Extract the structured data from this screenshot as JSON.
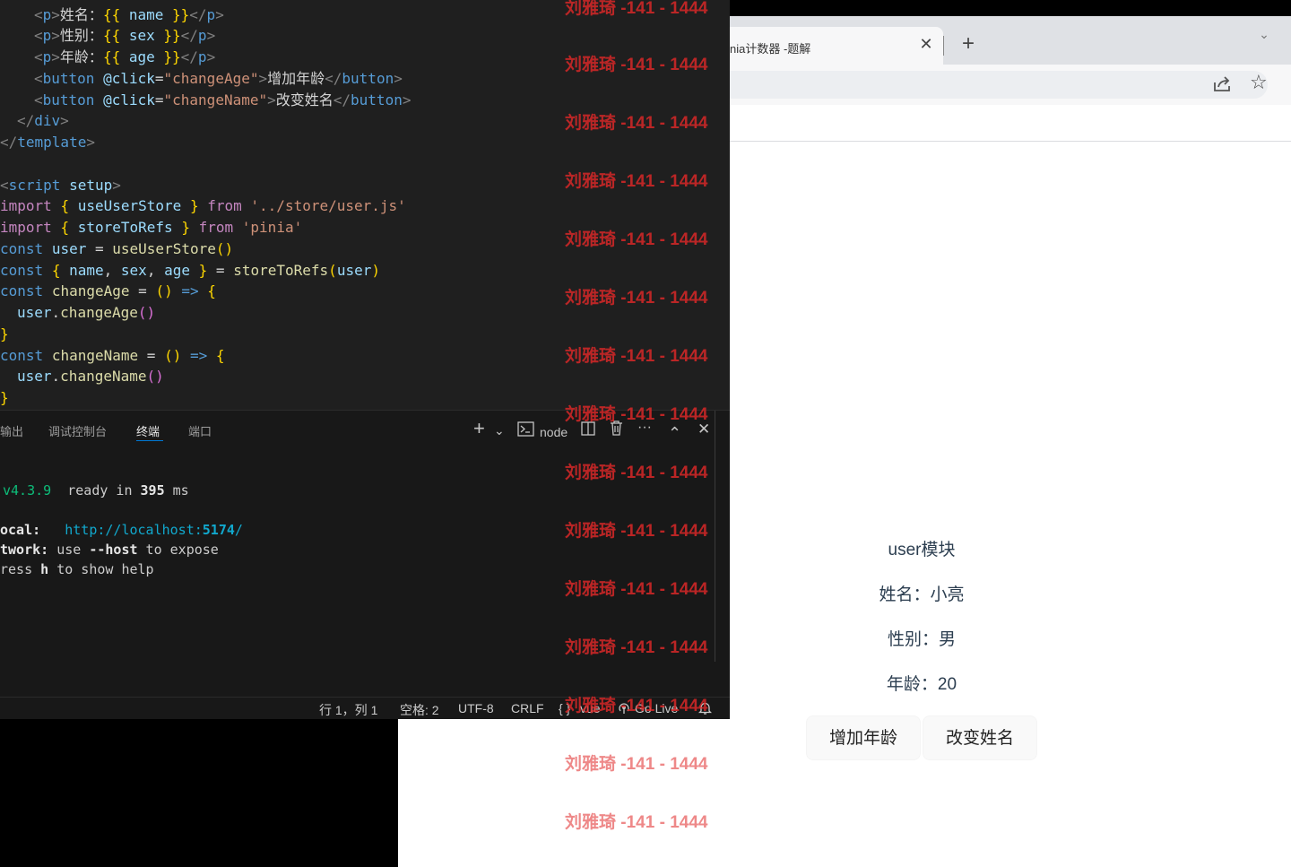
{
  "browser": {
    "tab_title": "nia计数器 -题解",
    "close_glyph": "✕",
    "new_tab_glyph": "+",
    "tab_search_glyph": "⌄",
    "star_glyph": "☆"
  },
  "app": {
    "title": "user模块",
    "name_line": "姓名：小亮",
    "sex_line": "性别：男",
    "age_line": "年龄：20",
    "btn_increase_age": "增加年龄",
    "btn_change_name": "改变姓名"
  },
  "editor": {
    "lines": [
      "  <p>姓名：{{ name }}</p>",
      "  <p>性别：{{ sex }}</p>",
      "  <p>年龄：{{ age }}</p>",
      "  <button @click=\"changeAge\">增加年龄</button>",
      "  <button @click=\"changeName\">改变姓名</button>",
      " </div>",
      "</template>",
      "",
      "<script setup>",
      "import { useUserStore } from '../store/user.js'",
      "import { storeToRefs } from 'pinia'",
      "const user = useUserStore()",
      "const { name, sex, age } = storeToRefs(user)",
      "const changeAge = () => {",
      "  user.changeAge()",
      "}",
      "const changeName = () => {",
      "  user.changeName()",
      "}"
    ]
  },
  "panel": {
    "tabs": [
      "输出",
      "调试控制台",
      "终端",
      "端口"
    ],
    "active_tab": "终端",
    "terminal_name": "node",
    "add_glyph": "+",
    "chevron_glyph": "⌄",
    "more_glyph": "···",
    "up_glyph": "⌃",
    "close_glyph": "✕",
    "terminal": {
      "version": "v4.3.9",
      "ready_prefix": "ready in ",
      "ready_ms": "395",
      "ready_suffix": " ms",
      "local_label": "ocal",
      "local_url_prefix": "http://localhost:",
      "local_port": "5174",
      "local_url_suffix": "/",
      "network_label": "twork",
      "network_text_1": "use ",
      "network_flag": "--host",
      "network_text_2": " to expose",
      "help_prefix": "ress ",
      "help_key": "h",
      "help_suffix": " to show help"
    }
  },
  "statusbar": {
    "position": "行 1，列 1",
    "spaces": "空格: 2",
    "encoding": "UTF-8",
    "eol": "CRLF",
    "language": "vue",
    "golive": "Go Live"
  },
  "watermark": {
    "text": "刘雅琦 -141 - 1444"
  },
  "colors": {
    "editor_bg": "#1f1f1f",
    "panel_bg": "#181818",
    "watermark": "#de2828",
    "browser_tabstrip": "#dfe1e5",
    "app_text": "#2c3e50"
  }
}
